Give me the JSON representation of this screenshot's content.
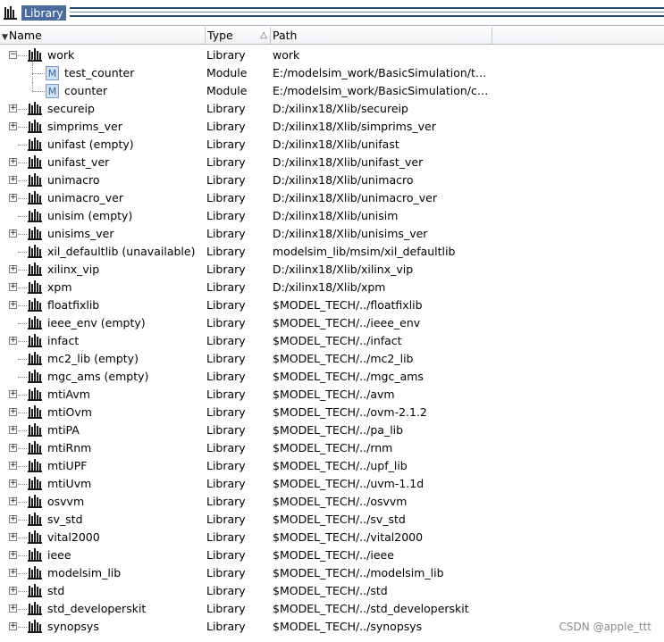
{
  "window": {
    "title": "Library"
  },
  "columns": {
    "name": "Name",
    "type": "Type",
    "path": "Path"
  },
  "rows": [
    {
      "name": "work",
      "type": "Library",
      "path": "work",
      "expander": "minus",
      "icon": "library-icon",
      "level": 0
    },
    {
      "name": "test_counter",
      "type": "Module",
      "path": "E:/modelsim_work/BasicSimulation/tco...",
      "expander": "",
      "icon": "module-icon",
      "level": 1
    },
    {
      "name": "counter",
      "type": "Module",
      "path": "E:/modelsim_work/BasicSimulation/cou...",
      "expander": "",
      "icon": "module-icon",
      "level": 1
    },
    {
      "name": "secureip",
      "type": "Library",
      "path": "D:/xilinx18/Xlib/secureip",
      "expander": "plus",
      "icon": "library-icon",
      "level": 0
    },
    {
      "name": "simprims_ver",
      "type": "Library",
      "path": "D:/xilinx18/Xlib/simprims_ver",
      "expander": "plus",
      "icon": "library-icon",
      "level": 0
    },
    {
      "name": "unifast  (empty)",
      "type": "Library",
      "path": "D:/xilinx18/Xlib/unifast",
      "expander": "",
      "icon": "library-icon",
      "level": 0
    },
    {
      "name": "unifast_ver",
      "type": "Library",
      "path": "D:/xilinx18/Xlib/unifast_ver",
      "expander": "plus",
      "icon": "library-icon",
      "level": 0
    },
    {
      "name": "unimacro",
      "type": "Library",
      "path": "D:/xilinx18/Xlib/unimacro",
      "expander": "plus",
      "icon": "library-icon",
      "level": 0
    },
    {
      "name": "unimacro_ver",
      "type": "Library",
      "path": "D:/xilinx18/Xlib/unimacro_ver",
      "expander": "plus",
      "icon": "library-icon",
      "level": 0
    },
    {
      "name": "unisim  (empty)",
      "type": "Library",
      "path": "D:/xilinx18/Xlib/unisim",
      "expander": "",
      "icon": "library-icon",
      "level": 0
    },
    {
      "name": "unisims_ver",
      "type": "Library",
      "path": "D:/xilinx18/Xlib/unisims_ver",
      "expander": "plus",
      "icon": "library-icon",
      "level": 0
    },
    {
      "name": "xil_defaultlib  (unavailable)",
      "type": "Library",
      "path": "modelsim_lib/msim/xil_defaultlib",
      "expander": "",
      "icon": "library-icon",
      "level": 0
    },
    {
      "name": "xilinx_vip",
      "type": "Library",
      "path": "D:/xilinx18/Xlib/xilinx_vip",
      "expander": "plus",
      "icon": "library-icon",
      "level": 0
    },
    {
      "name": "xpm",
      "type": "Library",
      "path": "D:/xilinx18/Xlib/xpm",
      "expander": "plus",
      "icon": "library-icon",
      "level": 0
    },
    {
      "name": "floatfixlib",
      "type": "Library",
      "path": "$MODEL_TECH/../floatfixlib",
      "expander": "plus",
      "icon": "library-icon",
      "level": 0
    },
    {
      "name": "ieee_env  (empty)",
      "type": "Library",
      "path": "$MODEL_TECH/../ieee_env",
      "expander": "",
      "icon": "library-icon",
      "level": 0
    },
    {
      "name": "infact",
      "type": "Library",
      "path": "$MODEL_TECH/../infact",
      "expander": "plus",
      "icon": "library-icon",
      "level": 0
    },
    {
      "name": "mc2_lib  (empty)",
      "type": "Library",
      "path": "$MODEL_TECH/../mc2_lib",
      "expander": "",
      "icon": "library-icon",
      "level": 0
    },
    {
      "name": "mgc_ams  (empty)",
      "type": "Library",
      "path": "$MODEL_TECH/../mgc_ams",
      "expander": "",
      "icon": "library-icon",
      "level": 0
    },
    {
      "name": "mtiAvm",
      "type": "Library",
      "path": "$MODEL_TECH/../avm",
      "expander": "plus",
      "icon": "library-icon",
      "level": 0
    },
    {
      "name": "mtiOvm",
      "type": "Library",
      "path": "$MODEL_TECH/../ovm-2.1.2",
      "expander": "plus",
      "icon": "library-icon",
      "level": 0
    },
    {
      "name": "mtiPA",
      "type": "Library",
      "path": "$MODEL_TECH/../pa_lib",
      "expander": "plus",
      "icon": "library-icon",
      "level": 0
    },
    {
      "name": "mtiRnm",
      "type": "Library",
      "path": "$MODEL_TECH/../rnm",
      "expander": "plus",
      "icon": "library-icon",
      "level": 0
    },
    {
      "name": "mtiUPF",
      "type": "Library",
      "path": "$MODEL_TECH/../upf_lib",
      "expander": "plus",
      "icon": "library-icon",
      "level": 0
    },
    {
      "name": "mtiUvm",
      "type": "Library",
      "path": "$MODEL_TECH/../uvm-1.1d",
      "expander": "plus",
      "icon": "library-icon",
      "level": 0
    },
    {
      "name": "osvvm",
      "type": "Library",
      "path": "$MODEL_TECH/../osvvm",
      "expander": "plus",
      "icon": "library-icon",
      "level": 0
    },
    {
      "name": "sv_std",
      "type": "Library",
      "path": "$MODEL_TECH/../sv_std",
      "expander": "plus",
      "icon": "library-icon",
      "level": 0
    },
    {
      "name": "vital2000",
      "type": "Library",
      "path": "$MODEL_TECH/../vital2000",
      "expander": "plus",
      "icon": "library-icon",
      "level": 0
    },
    {
      "name": "ieee",
      "type": "Library",
      "path": "$MODEL_TECH/../ieee",
      "expander": "plus",
      "icon": "library-icon",
      "level": 0
    },
    {
      "name": "modelsim_lib",
      "type": "Library",
      "path": "$MODEL_TECH/../modelsim_lib",
      "expander": "plus",
      "icon": "library-icon",
      "level": 0
    },
    {
      "name": "std",
      "type": "Library",
      "path": "$MODEL_TECH/../std",
      "expander": "plus",
      "icon": "library-icon",
      "level": 0
    },
    {
      "name": "std_developerskit",
      "type": "Library",
      "path": "$MODEL_TECH/../std_developerskit",
      "expander": "plus",
      "icon": "library-icon",
      "level": 0
    },
    {
      "name": "synopsys",
      "type": "Library",
      "path": "$MODEL_TECH/../synopsys",
      "expander": "plus",
      "icon": "library-icon",
      "level": 0
    }
  ],
  "watermark": "CSDN @apple_ttt",
  "colors": {
    "title_bg": "#4b6c9c",
    "title_fg": "#ffffff",
    "module_icon": "#8fb3e0",
    "library_icon": "#1a1a1a"
  }
}
